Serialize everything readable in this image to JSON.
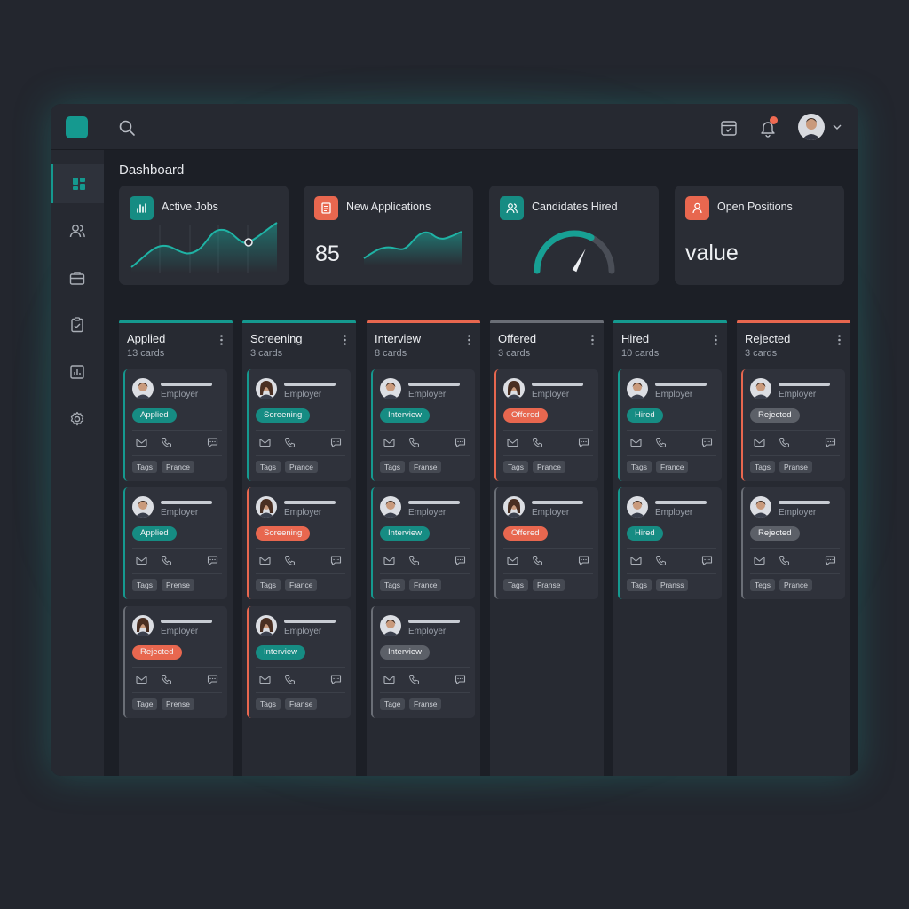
{
  "colors": {
    "accent_teal": "#15998f",
    "accent_coral": "#e8674f",
    "neutral_gray": "#5c6068",
    "background": "#1c1f26",
    "panel": "#2a2d35"
  },
  "topbar": {
    "icons": [
      "logo",
      "search-icon",
      "calendar-icon",
      "bell-icon",
      "user-avatar",
      "chevron-down-icon"
    ]
  },
  "sidebar": {
    "items": [
      {
        "icon": "dashboard-icon",
        "active": true
      },
      {
        "icon": "users-icon",
        "active": false
      },
      {
        "icon": "briefcase-icon",
        "active": false
      },
      {
        "icon": "clipboard-check-icon",
        "active": false
      },
      {
        "icon": "bar-chart-icon",
        "active": false
      },
      {
        "icon": "settings-icon",
        "active": false
      }
    ]
  },
  "main": {
    "title": "Dashboard",
    "stats": [
      {
        "label": "Active Jobs",
        "icon": "bar-chart-icon",
        "value": ""
      },
      {
        "label": "New Applications",
        "icon": "document-icon",
        "value": "85"
      },
      {
        "label": "Candidates Hired",
        "icon": "users-icon",
        "gauge_fraction": 0.65
      },
      {
        "label": "Open Positions",
        "icon": "user-icon",
        "value": "value"
      }
    ],
    "columns": [
      {
        "title": "Applied",
        "count": "13 cards",
        "accent": "#15998f",
        "cards": [
          {
            "employer": "Employer",
            "status": "Applied",
            "status_color": "teal",
            "tags": [
              "Tags",
              "Prance"
            ],
            "border": "#15998f",
            "avatar": "male"
          },
          {
            "employer": "Employer",
            "status": "Applied",
            "status_color": "teal",
            "tags": [
              "Tags",
              "Prense"
            ],
            "border": "#15998f",
            "avatar": "male"
          },
          {
            "employer": "Employer",
            "status": "Rejected",
            "status_color": "coral",
            "tags": [
              "Tage",
              "Prense"
            ],
            "border": "#6a6e76",
            "avatar": "female"
          }
        ]
      },
      {
        "title": "Screening",
        "count": "3 cards",
        "accent": "#15998f",
        "cards": [
          {
            "employer": "Employer",
            "status": "Soreening",
            "status_color": "teal",
            "tags": [
              "Tags",
              "Prance"
            ],
            "border": "#15998f",
            "avatar": "female"
          },
          {
            "employer": "Employer",
            "status": "Soreening",
            "status_color": "coral",
            "tags": [
              "Tags",
              "France"
            ],
            "border": "#e8674f",
            "avatar": "female"
          },
          {
            "employer": "Employer",
            "status": "Interview",
            "status_color": "teal",
            "tags": [
              "Tags",
              "Franse"
            ],
            "border": "#e8674f",
            "avatar": "female"
          }
        ]
      },
      {
        "title": "Interview",
        "count": "8 cards",
        "accent": "#e8674f",
        "cards": [
          {
            "employer": "Employer",
            "status": "Interview",
            "status_color": "teal",
            "tags": [
              "Tags",
              "Franse"
            ],
            "border": "#15998f",
            "avatar": "male"
          },
          {
            "employer": "Employer",
            "status": "Interview",
            "status_color": "teal",
            "tags": [
              "Tags",
              "France"
            ],
            "border": "#15998f",
            "avatar": "male"
          },
          {
            "employer": "Employer",
            "status": "Interview",
            "status_color": "gray",
            "tags": [
              "Tage",
              "Franse"
            ],
            "border": "#6a6e76",
            "avatar": "male"
          }
        ]
      },
      {
        "title": "Offered",
        "count": "3 cards",
        "accent": "#6a6e76",
        "cards": [
          {
            "employer": "Employer",
            "status": "Offered",
            "status_color": "coral",
            "tags": [
              "Tags",
              "Prance"
            ],
            "border": "#e8674f",
            "avatar": "female"
          },
          {
            "employer": "Employer",
            "status": "Offered",
            "status_color": "coral",
            "tags": [
              "Tags",
              "Franse"
            ],
            "border": "#6a6e76",
            "avatar": "female"
          }
        ]
      },
      {
        "title": "Hired",
        "count": "10 cards",
        "accent": "#15998f",
        "cards": [
          {
            "employer": "Employer",
            "status": "Hired",
            "status_color": "teal",
            "tags": [
              "Tags",
              "France"
            ],
            "border": "#15998f",
            "avatar": "male"
          },
          {
            "employer": "Employer",
            "status": "Hired",
            "status_color": "teal",
            "tags": [
              "Tags",
              "Pranss"
            ],
            "border": "#15998f",
            "avatar": "male"
          }
        ]
      },
      {
        "title": "Rejected",
        "count": "3 cards",
        "accent": "#e8674f",
        "cards": [
          {
            "employer": "Employer",
            "status": "Rejected",
            "status_color": "gray",
            "tags": [
              "Tags",
              "Pranse"
            ],
            "border": "#e8674f",
            "avatar": "male"
          },
          {
            "employer": "Employer",
            "status": "Rejected",
            "status_color": "gray",
            "tags": [
              "Tegs",
              "Prance"
            ],
            "border": "#6a6e76",
            "avatar": "male"
          }
        ]
      }
    ]
  }
}
